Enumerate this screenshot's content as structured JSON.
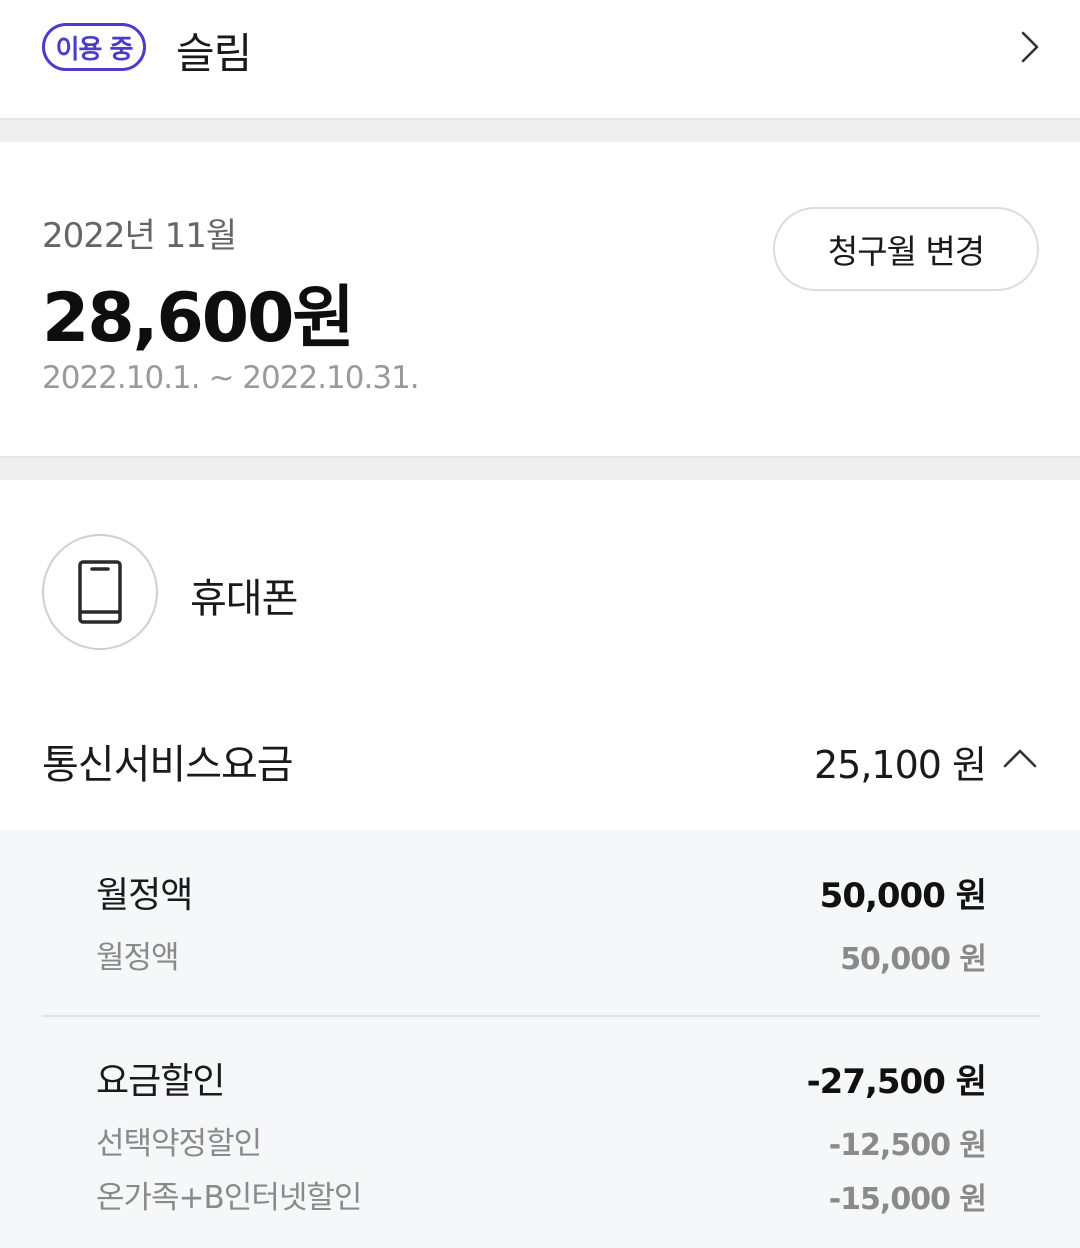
{
  "plan": {
    "status": "이용 중",
    "name": "슬림"
  },
  "bill": {
    "month": "2022년 11월",
    "total": "28,600원",
    "period": "2022.10.1. ~ 2022.10.31.",
    "change_month_label": "청구월 변경"
  },
  "device": {
    "icon": "phone-icon",
    "label": "휴대폰"
  },
  "service": {
    "title": "통신서비스요금",
    "amount": "25,100 원",
    "expanded": true
  },
  "details": [
    {
      "title": "월정액",
      "amount": "50,000 원",
      "items": [
        {
          "label": "월정액",
          "amount": "50,000 원"
        }
      ]
    },
    {
      "title": "요금할인",
      "amount": "-27,500 원",
      "items": [
        {
          "label": "선택약정할인",
          "amount": "-12,500 원"
        },
        {
          "label": "온가족+B인터넷할인",
          "amount": "-15,000 원"
        }
      ]
    }
  ],
  "colors": {
    "accent": "#4b3cc9",
    "panel_bg": "#f6f7f9",
    "separator": "#efefef"
  }
}
